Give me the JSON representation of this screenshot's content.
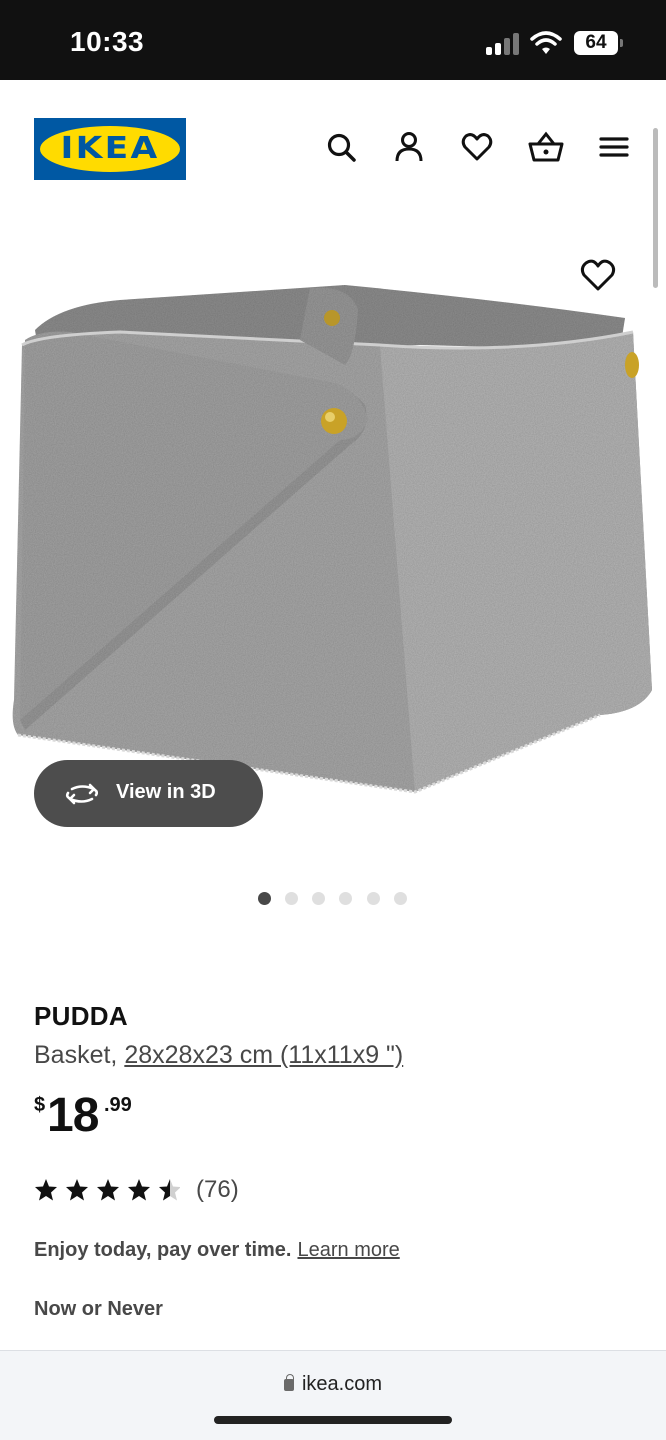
{
  "status_bar": {
    "time": "10:33",
    "battery": "64"
  },
  "header": {
    "logo_text": "IKEA",
    "icons": [
      "search-icon",
      "account-icon",
      "favorites-icon",
      "cart-icon",
      "menu-icon"
    ]
  },
  "gallery": {
    "view_3d_label": "View in 3D",
    "image_count": 6,
    "active_index": 0
  },
  "product": {
    "name": "PUDDA",
    "description_prefix": "Basket, ",
    "dimensions_link": "28x28x23 cm (11x11x9 \")",
    "price_currency": "$",
    "price_whole": "18",
    "price_decimal": ".99",
    "rating_stars": 4.5,
    "rating_count": "(76)",
    "financing_text": "Enjoy today, pay over time.",
    "financing_link": "Learn more",
    "promo_label": "Now or Never"
  },
  "browser": {
    "url": "ikea.com"
  },
  "colors": {
    "ikea_blue": "#0058a3",
    "ikea_yellow": "#ffdb00",
    "view3d_bg": "#4d4d4d"
  }
}
